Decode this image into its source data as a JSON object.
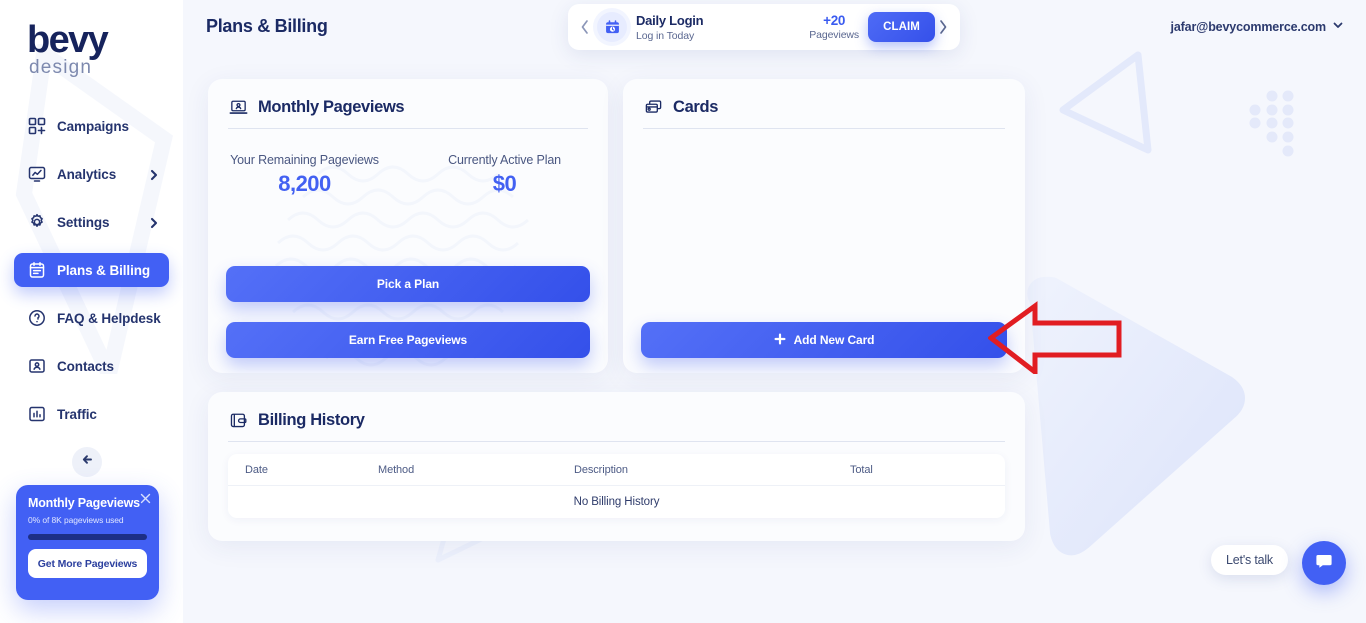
{
  "brand": {
    "name": "bevy",
    "tagline": "design"
  },
  "sidebar": {
    "items": [
      {
        "label": "Campaigns",
        "icon": "grid-plus-icon",
        "active": false,
        "chevron": false
      },
      {
        "label": "Analytics",
        "icon": "monitor-chart-icon",
        "active": false,
        "chevron": true
      },
      {
        "label": "Settings",
        "icon": "gear-icon",
        "active": false,
        "chevron": true
      },
      {
        "label": "Plans & Billing",
        "icon": "calendar-list-icon",
        "active": true,
        "chevron": false
      },
      {
        "label": "FAQ & Helpdesk",
        "icon": "question-circle-icon",
        "active": false,
        "chevron": false
      },
      {
        "label": "Contacts",
        "icon": "contact-card-icon",
        "active": false,
        "chevron": false
      },
      {
        "label": "Traffic",
        "icon": "bar-chart-icon",
        "active": false,
        "chevron": false
      }
    ],
    "collapse_icon": "arrow-left-icon",
    "promo": {
      "title": "Monthly Pageviews",
      "subtitle": "0% of 8K pageviews used",
      "progress_percent": 0,
      "button_label": "Get More Pageviews",
      "close_icon": "close-icon",
      "accent": "#4260f4"
    }
  },
  "header": {
    "page_title": "Plans & Billing",
    "account_email": "jafar@bevycommerce.com",
    "account_chevron_icon": "chevron-down-icon"
  },
  "banner": {
    "prev_icon": "chevron-left-icon",
    "next_icon": "chevron-right-icon",
    "icon": "calendar-clock-icon",
    "title": "Daily Login",
    "subtitle": "Log in Today",
    "points": "+20",
    "points_label": "Pageviews",
    "claim_label": "CLAIM"
  },
  "pageviews_panel": {
    "icon": "laptop-user-icon",
    "title": "Monthly Pageviews",
    "stats": [
      {
        "label": "Your Remaining Pageviews",
        "value": "8,200"
      },
      {
        "label": "Currently Active Plan",
        "value": "$0"
      }
    ],
    "primary_button": "Pick a Plan",
    "secondary_button": "Earn Free Pageviews"
  },
  "cards_panel": {
    "icon": "credit-cards-icon",
    "title": "Cards",
    "add_button": "Add New Card",
    "add_button_icon": "plus-icon",
    "items": []
  },
  "billing_panel": {
    "icon": "wallet-icon",
    "title": "Billing History",
    "columns": [
      "Date",
      "Method",
      "Description",
      "Total"
    ],
    "rows": [],
    "empty_message": "No Billing History"
  },
  "chat": {
    "label": "Let's talk",
    "icon": "chat-bubble-icon",
    "accent": "#4260f4"
  },
  "annotation": {
    "arrow_icon": "arrow-left-annotation",
    "color": "#e11d22",
    "points_at": "Add New Card"
  },
  "theme": {
    "accent": "#4260f4",
    "accent_dark": "#3450ea",
    "text_dark": "#1b2a64",
    "text_muted": "#4a5781",
    "page_bg": "#f5f7fd",
    "panel_bg": "#fbfcfe"
  }
}
